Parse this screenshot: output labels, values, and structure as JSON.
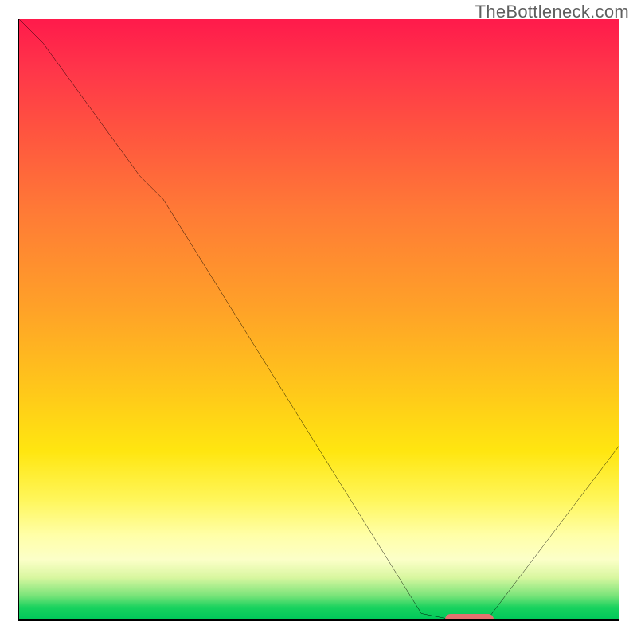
{
  "watermark": "TheBottleneck.com",
  "chart_data": {
    "type": "line",
    "title": "",
    "xlabel": "",
    "ylabel": "",
    "xlim": [
      0,
      100
    ],
    "ylim": [
      0,
      100
    ],
    "x": [
      0,
      4,
      20,
      24,
      67,
      72,
      78,
      100
    ],
    "values": [
      100,
      96,
      74,
      70,
      1,
      0,
      0,
      29
    ],
    "marker": {
      "x_start": 71,
      "x_end": 79,
      "y": 0
    },
    "gradient_bands_top_to_bottom": [
      "red",
      "orange",
      "yellow",
      "pale-yellow",
      "green"
    ]
  }
}
